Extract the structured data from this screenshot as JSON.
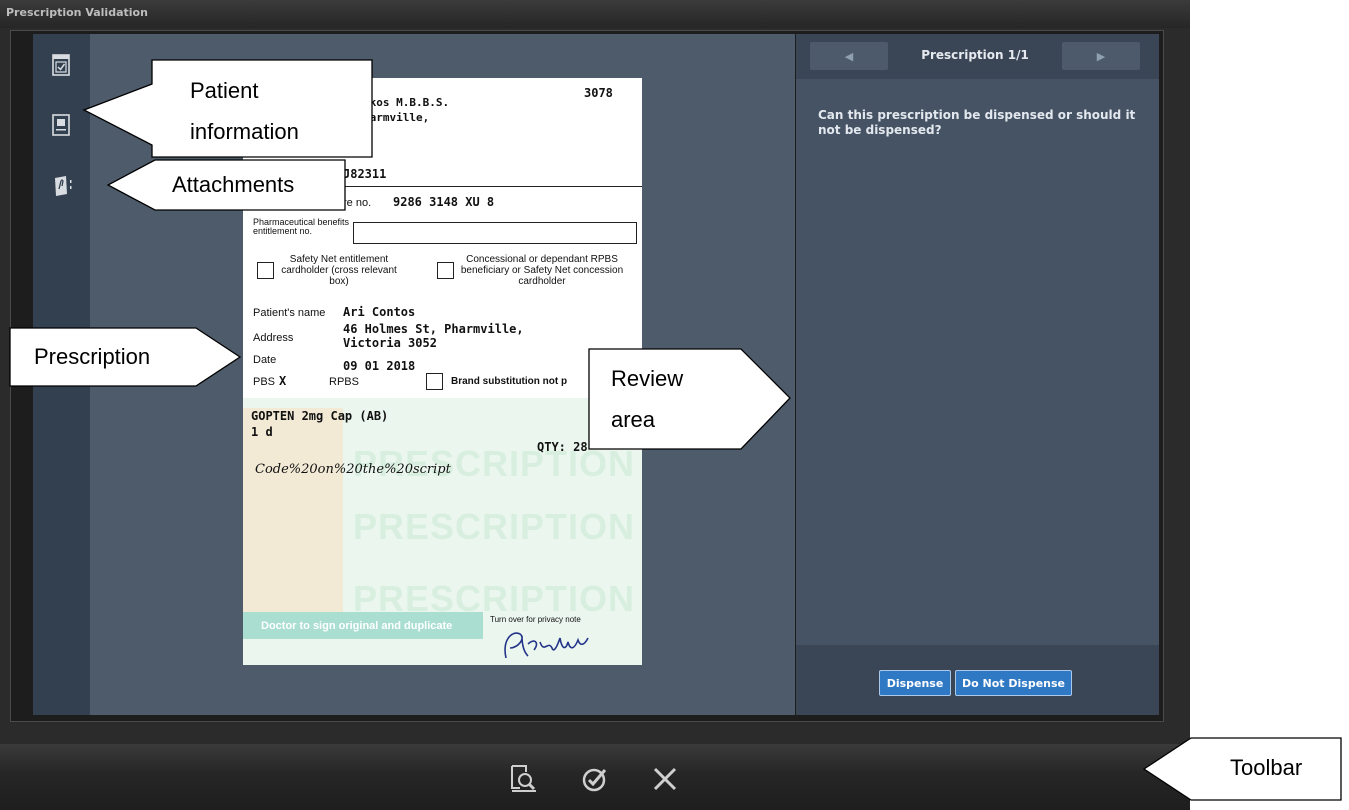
{
  "window": {
    "title": "Prescription Validation"
  },
  "review_panel": {
    "nav_prev_label": "◀",
    "nav_next_label": "▶",
    "nav_title": "Prescription 1/1",
    "question": "Can this prescription be dispensed or should it not be dispensed?",
    "dispense_label": "Dispense",
    "do_not_dispense_label": "Do Not Dispense"
  },
  "prescription": {
    "prescriber_number": "3078",
    "prescriber_name": "ikos M.B.B.S.",
    "prescriber_town": "harmville,",
    "prescriber_code": "J82311",
    "medicare_label": "re no.",
    "medicare_number": "9286 3148 XU 8",
    "benefits_label": "Pharmaceutical benefits entitlement no.",
    "safety_net_label": "Safety Net entitlement cardholder (cross relevant box)",
    "concessional_label": "Concessional or dependant RPBS beneficiary or Safety Net concession cardholder",
    "patient_name_label": "Patient's name",
    "patient_name": "Ari Contos",
    "address_label": "Address",
    "address_line1": "46 Holmes St, Pharmville,",
    "address_line2": "Victoria 3052",
    "date_label": "Date",
    "date": "09 01 2018",
    "pbs_label": "PBS",
    "pbs_mark": "X",
    "rpbs_label": "RPBS",
    "brand_sub_label": "Brand substitution not p",
    "drug": "GOPTEN 2mg Cap (AB)",
    "dose": "1 d",
    "qty": "QTY: 28",
    "code_line": "Code%20on%20the%20script",
    "watermark": "PRESCRIPTION",
    "sign_label": "Doctor to sign original and duplicate",
    "privacy_note": "Turn over for privacy note",
    "signature": "PKakantos"
  },
  "annotations": {
    "patient_information": "Patient information",
    "patient_information_line1": "Patient",
    "patient_information_line2": "information",
    "attachments": "Attachments",
    "prescription": "Prescription",
    "review_area_line1": "Review",
    "review_area_line2": "area",
    "toolbar": "Toolbar"
  },
  "colors": {
    "rail": "#33404f",
    "preview": "#4e5b6a",
    "review": "#455364",
    "accent_button": "#2f78c4"
  }
}
